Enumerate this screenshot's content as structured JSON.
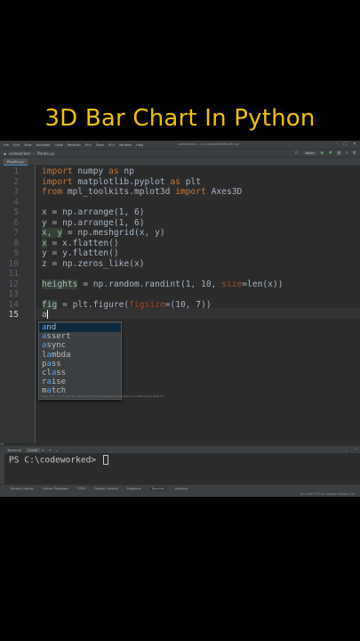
{
  "headline": "3D Bar Chart In Python",
  "menubar": {
    "items": [
      "File",
      "Edit",
      "View",
      "Navigate",
      "Code",
      "Refactor",
      "Run",
      "Tools",
      "VCS",
      "Window",
      "Help"
    ],
    "title": "codeworked - C:\\codeworked\\Plan6n.py"
  },
  "navbar": {
    "breadcrumb": [
      "codeworked",
      "Plan6n.py"
    ],
    "run_config": "main"
  },
  "editor_tab": "Plan6n.py",
  "line_numbers": [
    "1",
    "2",
    "3",
    "4",
    "5",
    "6",
    "7",
    "8",
    "9",
    "10",
    "11",
    "12",
    "13",
    "14",
    "15"
  ],
  "code": {
    "l1": {
      "kw1": "import",
      "mod": " numpy ",
      "kw2": "as",
      "alias": " np"
    },
    "l2": {
      "kw1": "import",
      "mod": " matplotlib.pyplot ",
      "kw2": "as",
      "alias": " plt"
    },
    "l3": {
      "kw1": "from",
      "mod": " mpl_toolkits.mplot3d ",
      "kw2": "import",
      "alias": " Axes3D"
    },
    "l5": "x = np.arrange(1, 6)",
    "l6": "y = np.arrange(1, 6)",
    "l7": {
      "hl": "x, y",
      "rest": " = np.meshgrid(x, y)"
    },
    "l8": {
      "hl": "x",
      "rest": " = x.flatten()"
    },
    "l9": "y = y.flatten()",
    "l10": "z = np.zeros_like(x)",
    "l12": {
      "hl": "heights",
      "rest": " = np.random.randint(1, 10, ",
      "param": "size",
      "tail": "=len(x))"
    },
    "l14": {
      "hl": "fig",
      "rest": " = plt.figure(",
      "param": "figsize",
      "tail": "=(10, 7))"
    },
    "l15": "a"
  },
  "completion": {
    "items": [
      "and",
      "assert",
      "async",
      "lambda",
      "pass",
      "class",
      "raise",
      "match"
    ],
    "match_chars": [
      "a",
      "a",
      "a",
      "a",
      "a",
      "a",
      "a",
      "a"
    ],
    "selected_index": 0,
    "hint": "Press Ctrl+. to choose the selected (or first) suggestion and insert a dot afterwards  Next Tip"
  },
  "terminal": {
    "tab_label": "Terminal",
    "session": "Local",
    "prompt": "PS C:\\codeworked> "
  },
  "toolwindows": [
    "Version Control",
    "Python Packages",
    "TODO",
    "Python Console",
    "Problems",
    "Terminal",
    "Services"
  ],
  "statusbar": "15:1  CRLF  UTF-8  4 spaces  Python 3.10"
}
